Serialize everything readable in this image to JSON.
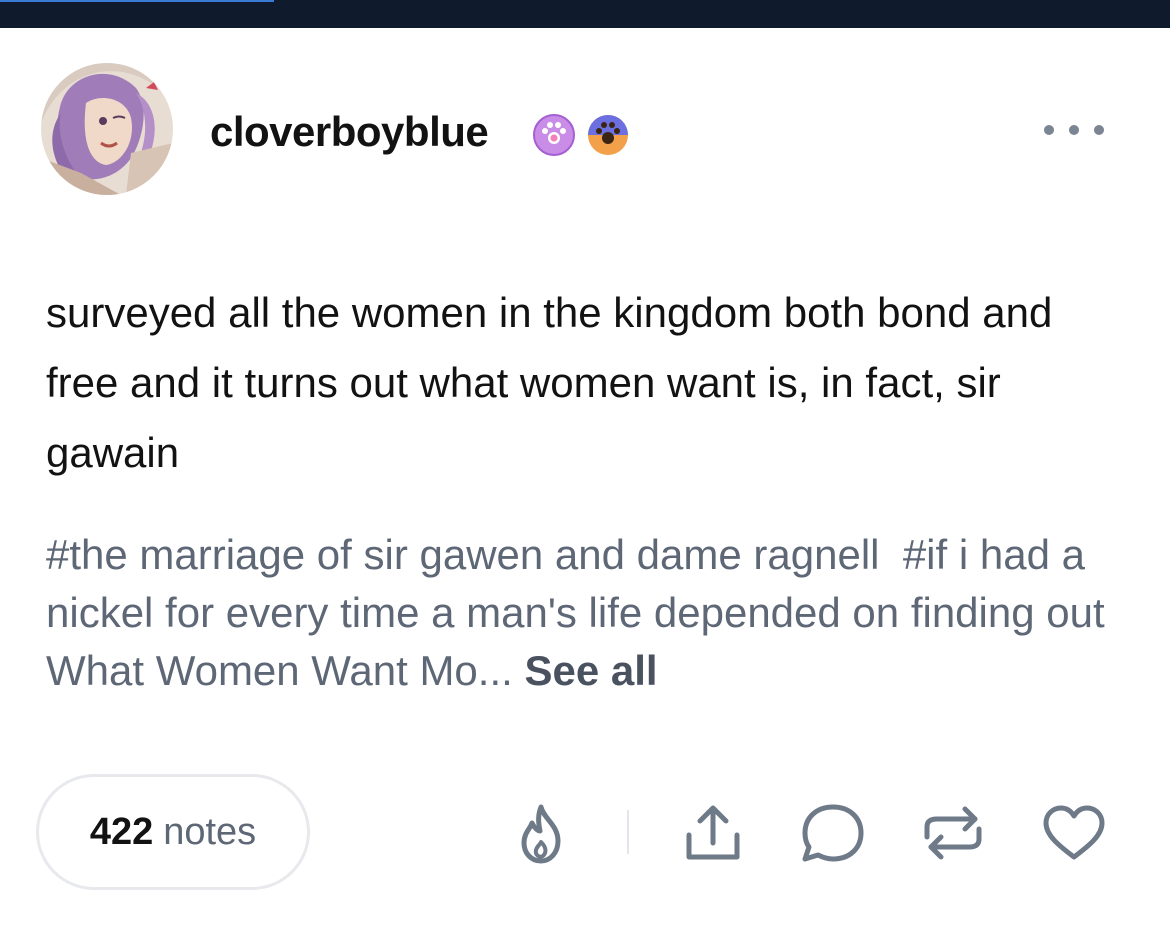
{
  "post": {
    "author": {
      "username": "cloverboyblue",
      "badges": [
        "paw-badge-pink",
        "paw-badge-orange"
      ]
    },
    "body": "surveyed all the women in the kingdom both bond and free and it turns out what women want is, in fact, sir gawain",
    "tags": [
      "#the marriage of sir gawen and dame ragnell",
      "#if i had a nickel for every time a man's life depended on finding out What Women Want Mo..."
    ],
    "see_all_label": "See all"
  },
  "footer": {
    "notes_count": "422",
    "notes_label": "notes",
    "actions": [
      "blaze-icon",
      "share-icon",
      "reply-icon",
      "reblog-icon",
      "like-icon"
    ]
  },
  "colors": {
    "topbar": "#0f1a2c",
    "text": "#121212",
    "secondary_text": "#5e6776",
    "icon": "#6f7a89",
    "pill_border": "#e7e9ec"
  }
}
